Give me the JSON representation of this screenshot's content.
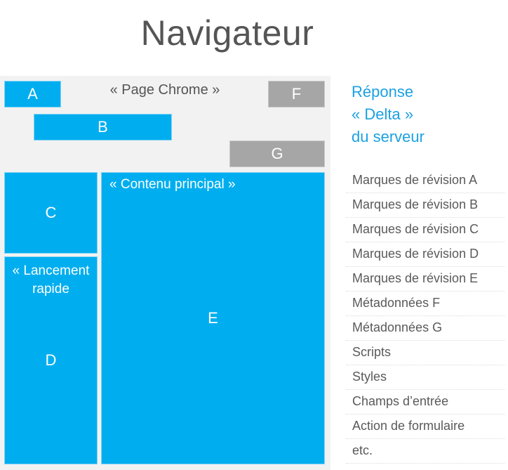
{
  "title": "Navigateur",
  "page_chrome": {
    "label": "« Page Chrome »",
    "blocks": {
      "A": "A",
      "B": "B",
      "F": "F",
      "G": "G"
    }
  },
  "layout": {
    "C": "C",
    "D": "D",
    "E": "E",
    "quick_launch_label_line1": "« Lancement",
    "quick_launch_label_line2": "rapide",
    "main_content_label": "« Contenu principal »"
  },
  "server_response": {
    "heading_lines": [
      "Réponse",
      "« Delta »",
      "du serveur"
    ],
    "items": [
      "Marques de révision A",
      "Marques de révision B",
      "Marques de révision C",
      "Marques de révision D",
      "Marques de révision E",
      "Métadonnées F",
      "Métadonnées G",
      "Scripts",
      "Styles",
      "Champs d’entrée",
      "Action de formulaire",
      "etc."
    ]
  },
  "colors": {
    "accent_blue": "#00aeef",
    "block_gray": "#a6a6a6",
    "panel_bg": "#f2f2f2",
    "heading_blue": "#1ba1e2"
  }
}
